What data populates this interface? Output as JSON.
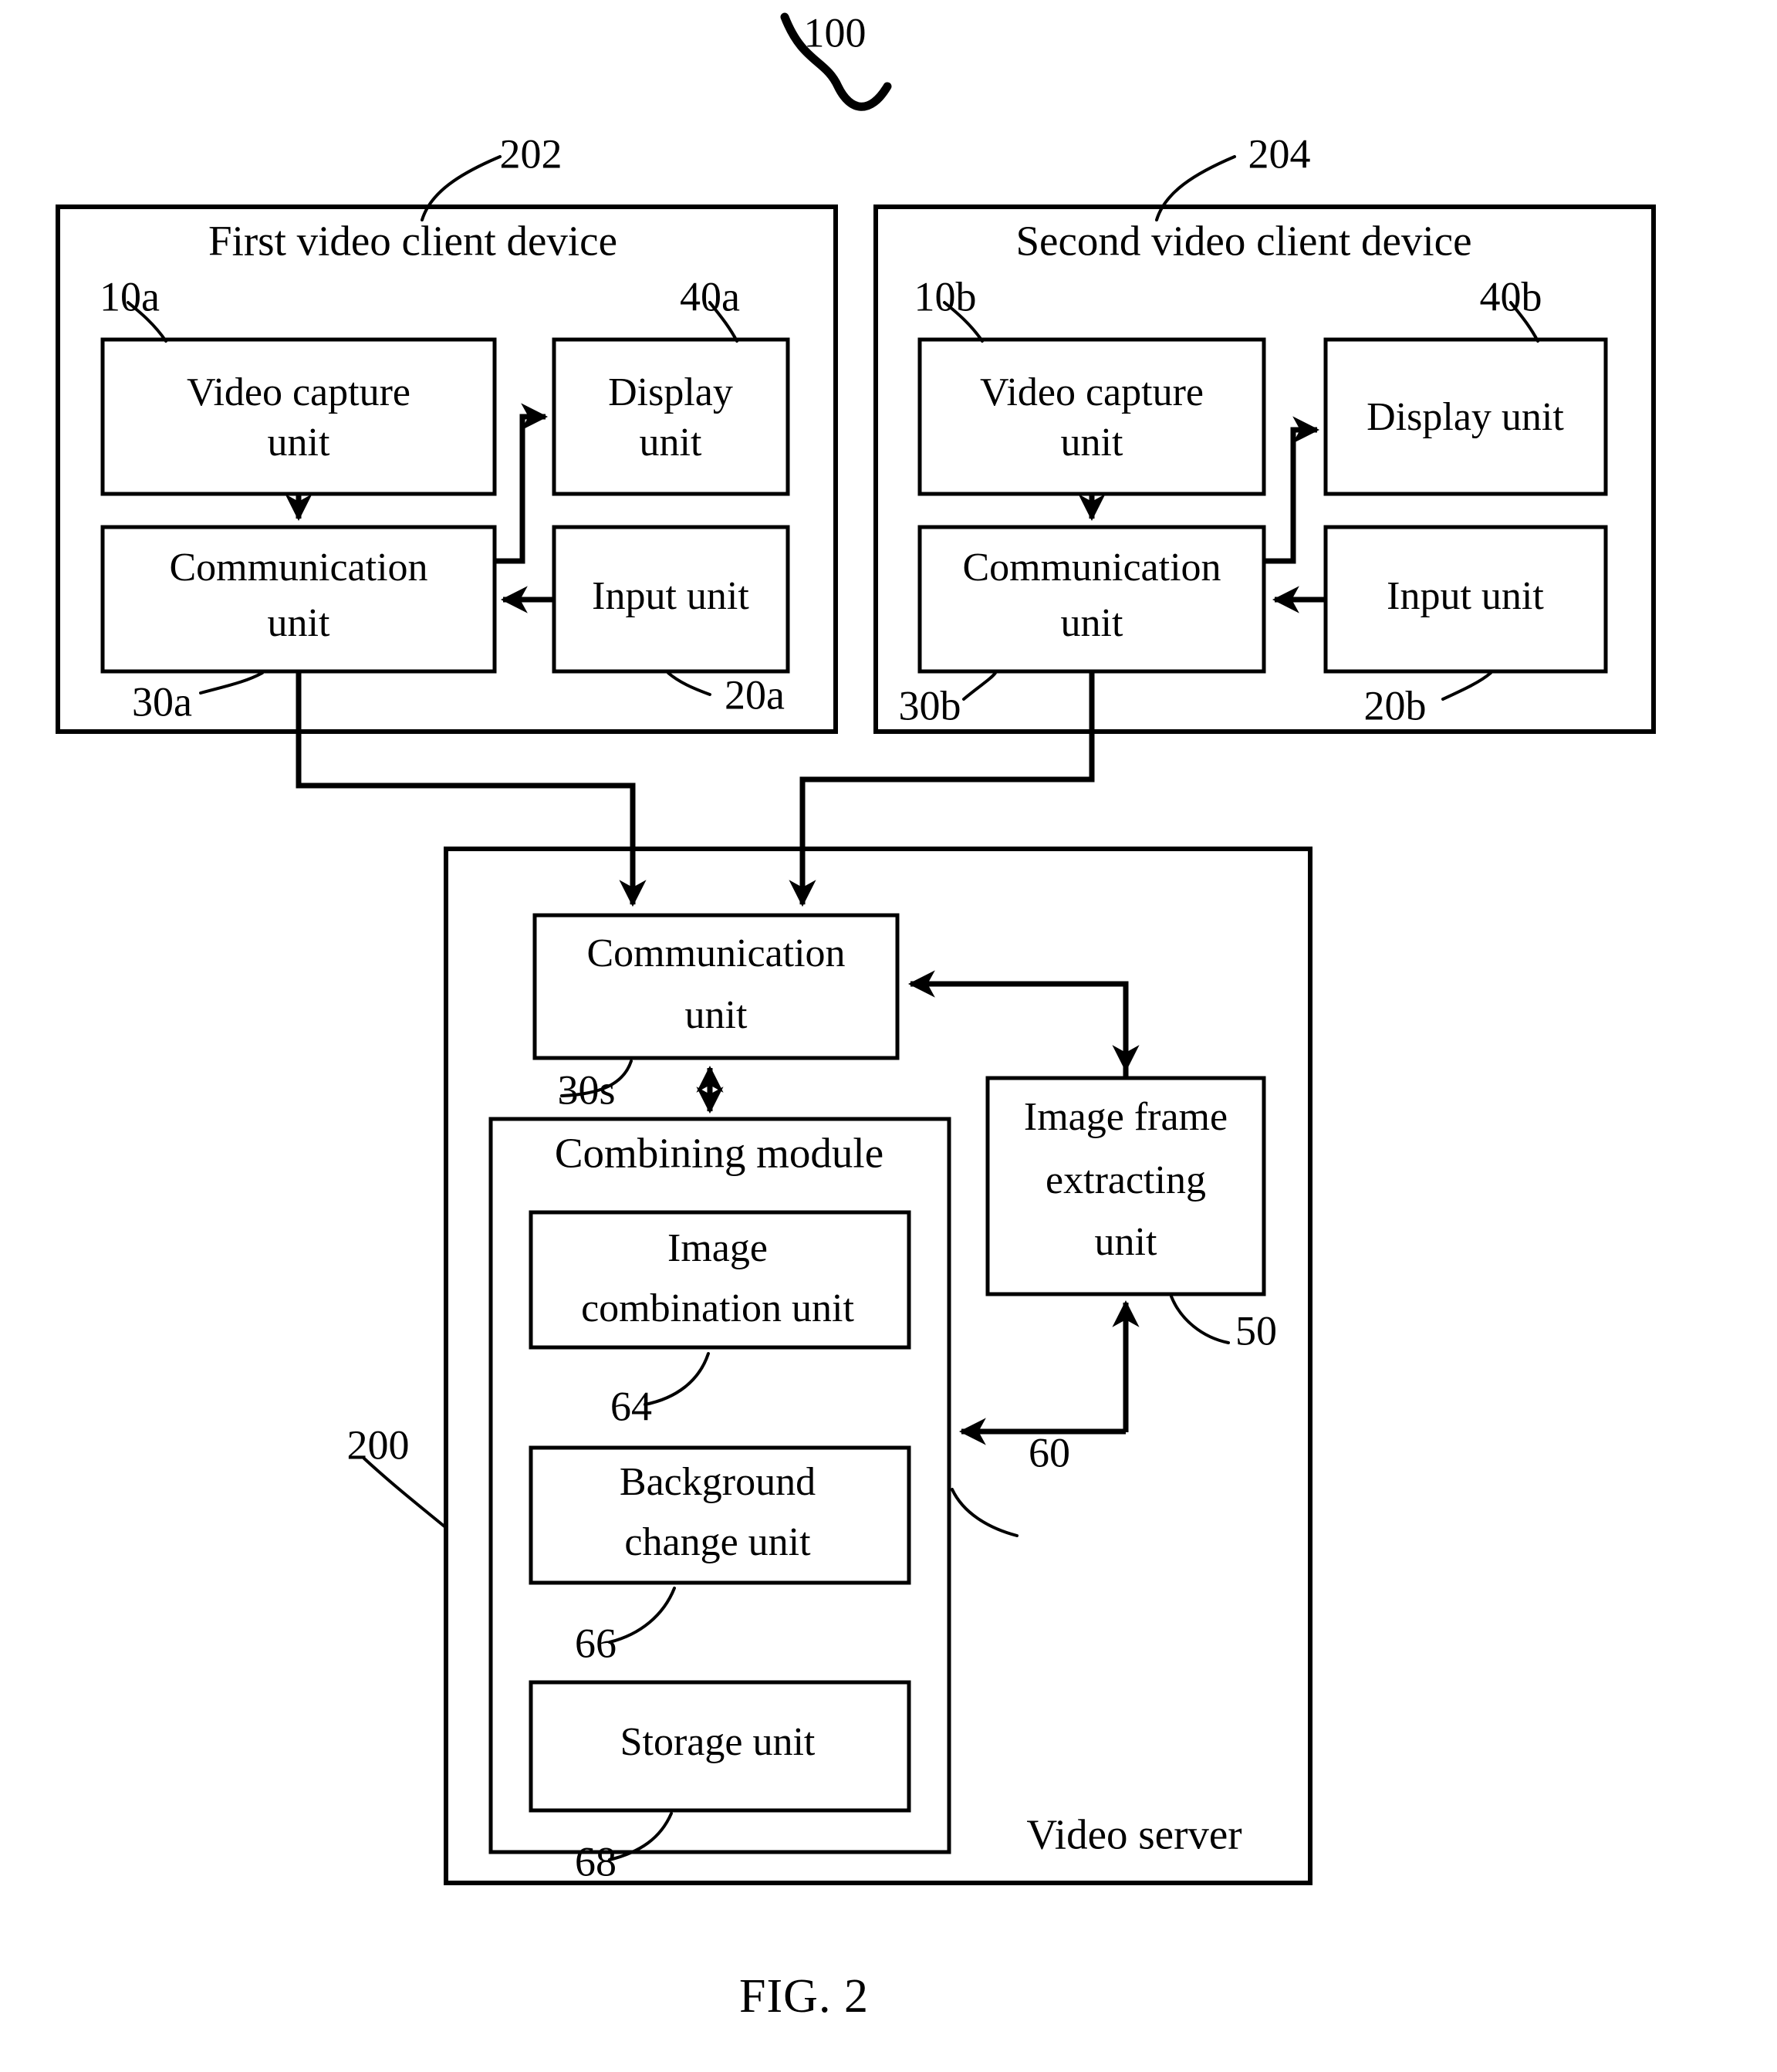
{
  "figure": {
    "caption": "FIG. 2",
    "system_ref": "100"
  },
  "clients": [
    {
      "title": "First video client device",
      "ref": "202",
      "units": [
        {
          "name": "Video capture unit",
          "line1": "Video capture",
          "line2": "unit",
          "ref": "10a"
        },
        {
          "name": "Display unit",
          "line1": "Display",
          "line2": "unit",
          "ref": "40a"
        },
        {
          "name": "Communication unit",
          "line1": "Communication",
          "line2": "unit",
          "ref": "30a"
        },
        {
          "name": "Input unit",
          "line1": "Input unit",
          "line2": "",
          "ref": "20a"
        }
      ]
    },
    {
      "title": "Second video client device",
      "ref": "204",
      "units": [
        {
          "name": "Video capture unit",
          "line1": "Video capture",
          "line2": "unit",
          "ref": "10b"
        },
        {
          "name": "Display unit",
          "line1": "Display unit",
          "line2": "",
          "ref": "40b"
        },
        {
          "name": "Communication unit",
          "line1": "Communication",
          "line2": "unit",
          "ref": "30b"
        },
        {
          "name": "Input unit",
          "line1": "Input unit",
          "line2": "",
          "ref": "20b"
        }
      ]
    }
  ],
  "server": {
    "title": "Video server",
    "ref": "200",
    "communication_unit": {
      "line1": "Communication",
      "line2": "unit",
      "ref": "30s"
    },
    "combining_module": {
      "title": "Combining module",
      "ref": "60",
      "units": [
        {
          "name": "Image combination unit",
          "line1": "Image",
          "line2": "combination unit",
          "ref": "64"
        },
        {
          "name": "Background change unit",
          "line1": "Background",
          "line2": "change unit",
          "ref": "66"
        },
        {
          "name": "Storage unit",
          "line1": "Storage unit",
          "line2": "",
          "ref": "68"
        }
      ]
    },
    "image_frame_extracting_unit": {
      "line1": "Image frame",
      "line2": "extracting",
      "line3": "unit",
      "ref": "50"
    }
  }
}
